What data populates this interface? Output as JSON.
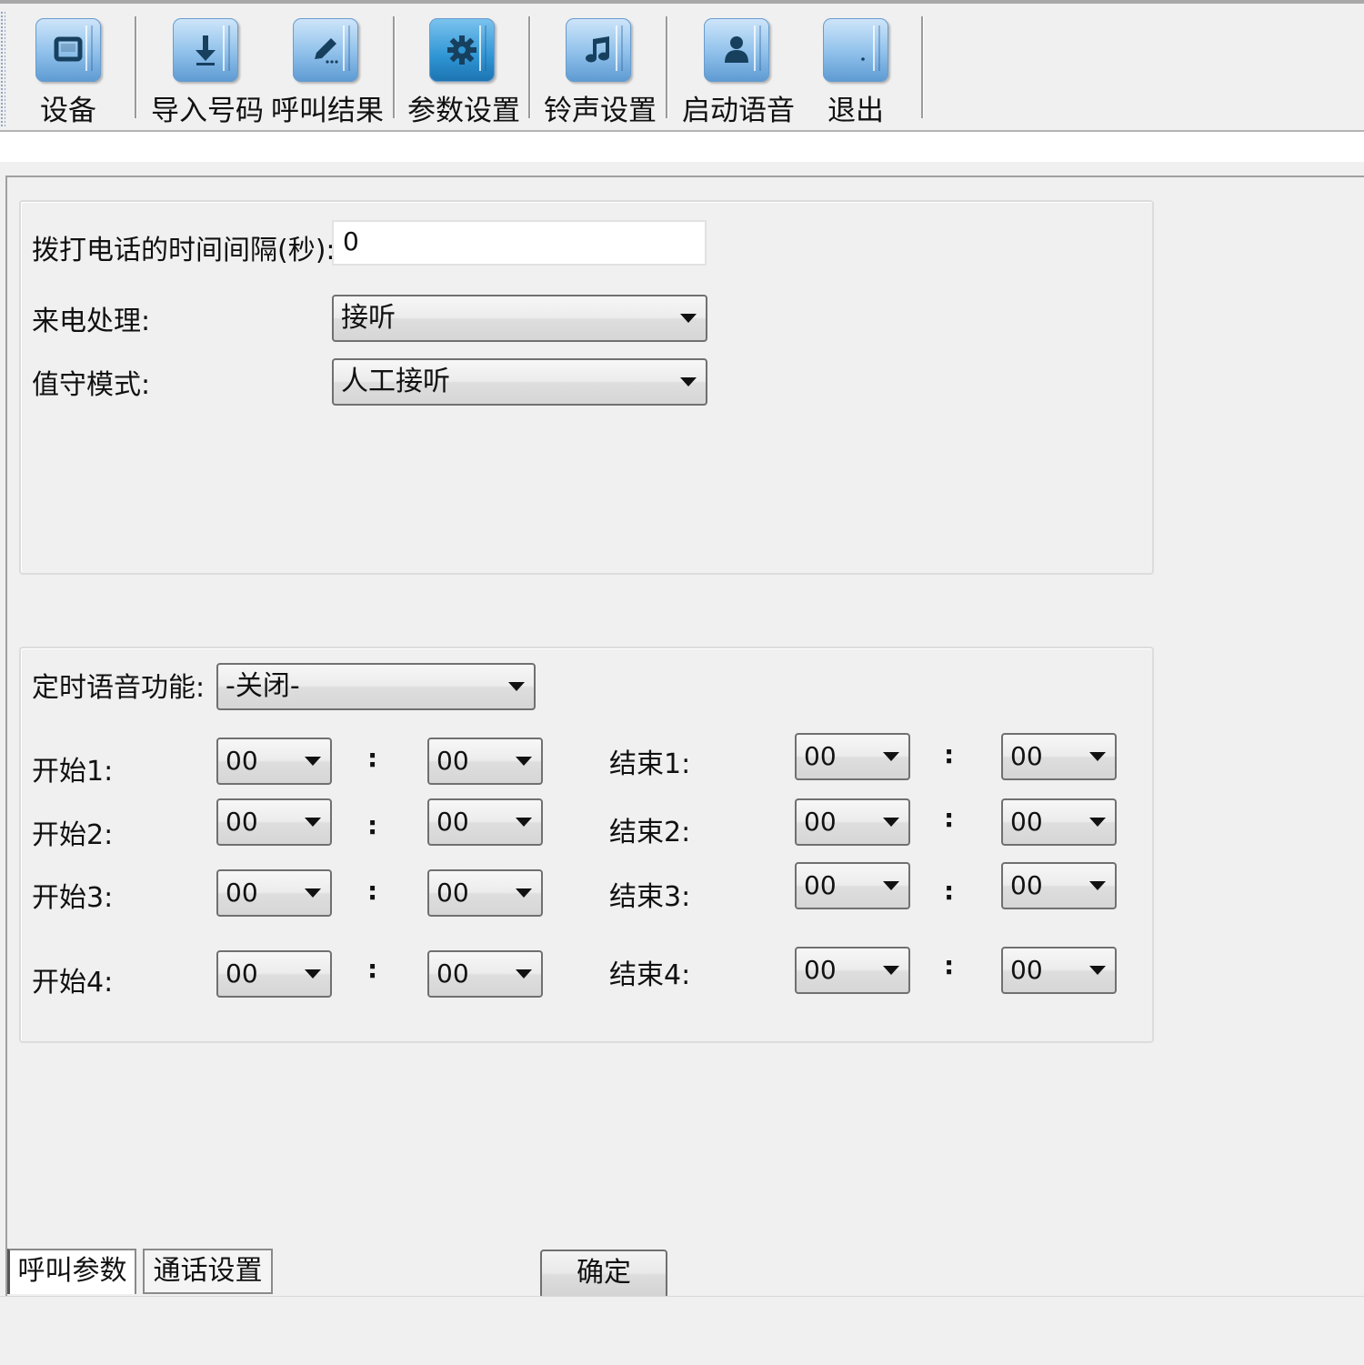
{
  "toolbar": {
    "buttons": [
      {
        "label": "设备",
        "icon": "device-icon"
      },
      {
        "label": "导入号码",
        "icon": "import-icon"
      },
      {
        "label": "呼叫结果",
        "icon": "edit-icon"
      },
      {
        "label": "参数设置",
        "icon": "gear-icon"
      },
      {
        "label": "铃声设置",
        "icon": "music-note-icon"
      },
      {
        "label": "启动语音",
        "icon": "person-icon"
      },
      {
        "label": "退出",
        "icon": "exit-icon"
      }
    ]
  },
  "call_params": {
    "interval_label": "拨打电话的时间间隔(秒):",
    "interval_value": "0",
    "incoming_label": "来电处理:",
    "incoming_value": "接听",
    "duty_label": "值守模式:",
    "duty_value": "人工接听"
  },
  "timed_voice": {
    "label": "定时语音功能:",
    "value": "-关闭-",
    "colon": ":",
    "rows": [
      {
        "start_label": "开始1:",
        "start_h": "00",
        "start_m": "00",
        "end_label": "结束1:",
        "end_h": "00",
        "end_m": "00"
      },
      {
        "start_label": "开始2:",
        "start_h": "00",
        "start_m": "00",
        "end_label": "结束2:",
        "end_h": "00",
        "end_m": "00"
      },
      {
        "start_label": "开始3:",
        "start_h": "00",
        "start_m": "00",
        "end_label": "结束3:",
        "end_h": "00",
        "end_m": "00"
      },
      {
        "start_label": "开始4:",
        "start_h": "00",
        "start_m": "00",
        "end_label": "结束4:",
        "end_h": "00",
        "end_m": "00"
      }
    ]
  },
  "tabs": [
    {
      "label": "呼叫参数",
      "active": true
    },
    {
      "label": "通话设置",
      "active": false
    }
  ],
  "confirm_label": "确定",
  "colors": {
    "icon_blue": "#8fc0ea",
    "icon_active": "#2f95d4",
    "icon_glyph": "#17405f"
  }
}
